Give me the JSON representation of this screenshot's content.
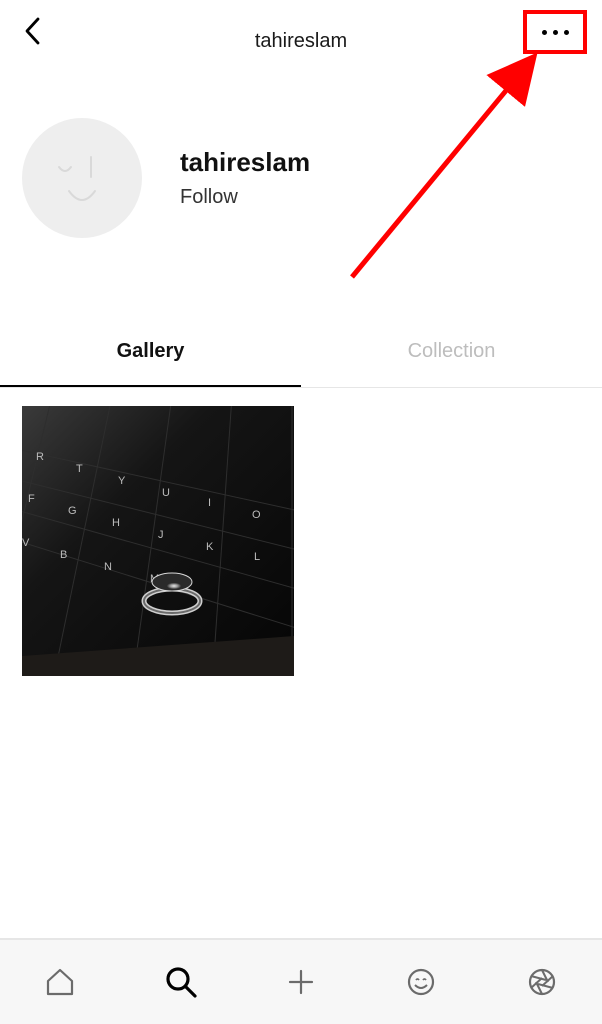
{
  "header": {
    "title": "tahireslam"
  },
  "profile": {
    "username": "tahireslam",
    "follow_label": "Follow"
  },
  "tabs": {
    "gallery": "Gallery",
    "collection": "Collection",
    "active": "gallery"
  },
  "gallery": {
    "items": [
      {
        "alt": "black-and-white photo of a ring on a laptop keyboard"
      }
    ]
  },
  "annotation": {
    "highlight_target": "more-options-button",
    "color": "#ff0000"
  },
  "bottomnav": {
    "items": [
      "home",
      "search",
      "add",
      "reactions",
      "settings"
    ],
    "active": "search"
  }
}
